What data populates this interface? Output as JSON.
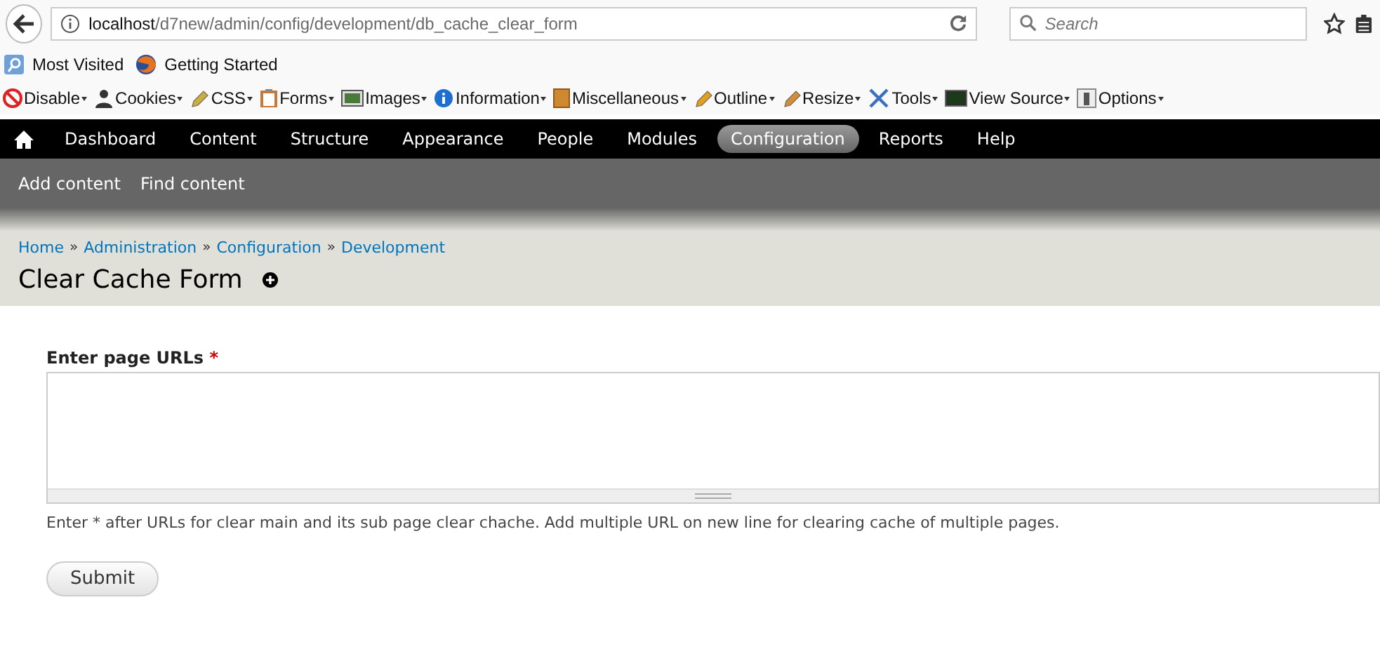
{
  "browser": {
    "url_host": "localhost",
    "url_path": "/d7new/admin/config/development/db_cache_clear_form",
    "search": {
      "placeholder": "Search"
    }
  },
  "bookmarks": [
    {
      "label": "Most Visited",
      "kind": "folder"
    },
    {
      "label": "Getting Started",
      "kind": "fox"
    }
  ],
  "webdev_toolbar": [
    {
      "label": "Disable",
      "kind": "disable"
    },
    {
      "label": "Cookies",
      "kind": "cookies"
    },
    {
      "label": "CSS",
      "kind": "css"
    },
    {
      "label": "Forms",
      "kind": "forms"
    },
    {
      "label": "Images",
      "kind": "images"
    },
    {
      "label": "Information",
      "kind": "info"
    },
    {
      "label": "Miscellaneous",
      "kind": "misc"
    },
    {
      "label": "Outline",
      "kind": "outline"
    },
    {
      "label": "Resize",
      "kind": "resize"
    },
    {
      "label": "Tools",
      "kind": "tools"
    },
    {
      "label": "View Source",
      "kind": "source"
    },
    {
      "label": "Options",
      "kind": "options"
    }
  ],
  "admin_menu": [
    {
      "label": "Dashboard",
      "selected": false
    },
    {
      "label": "Content",
      "selected": false
    },
    {
      "label": "Structure",
      "selected": false
    },
    {
      "label": "Appearance",
      "selected": false
    },
    {
      "label": "People",
      "selected": false
    },
    {
      "label": "Modules",
      "selected": false
    },
    {
      "label": "Configuration",
      "selected": true
    },
    {
      "label": "Reports",
      "selected": false
    },
    {
      "label": "Help",
      "selected": false
    }
  ],
  "shortcuts": [
    "Add content",
    "Find content"
  ],
  "breadcrumb": {
    "separator": "»",
    "items": [
      "Home",
      "Administration",
      "Configuration",
      "Development"
    ]
  },
  "page_title": "Clear Cache Form",
  "form": {
    "label": "Enter page URLs",
    "required_mark": "*",
    "description": "Enter * after URLs for clear main and its sub page clear chache. Add multiple URL on new line for clearing cache of multiple pages.",
    "submit": "Submit"
  }
}
